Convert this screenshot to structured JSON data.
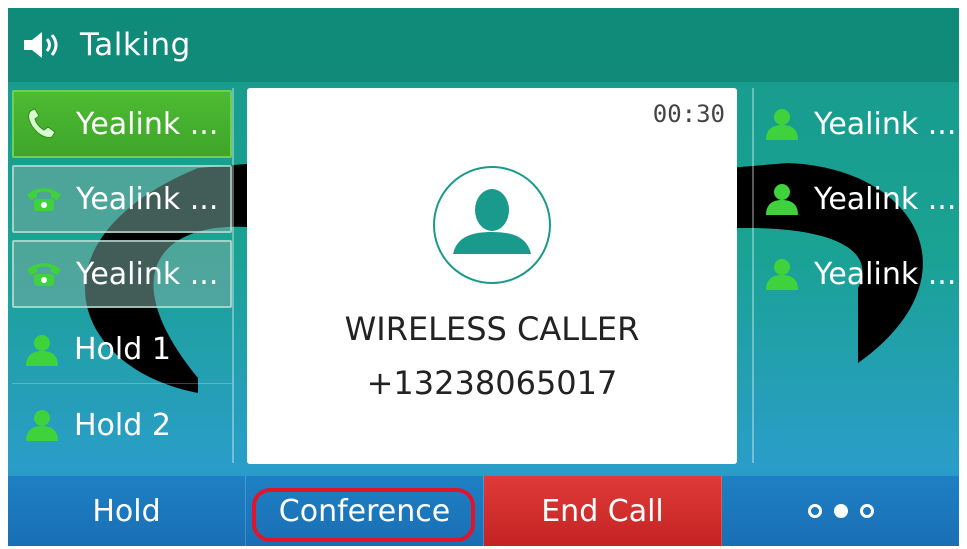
{
  "status": {
    "title": "Talking",
    "icon": "speaker-icon"
  },
  "left_lines": [
    {
      "label": "Yealink ...",
      "icon": "phone-active-icon",
      "state": "active"
    },
    {
      "label": "Yealink ...",
      "icon": "phone-hold-icon",
      "state": "held"
    },
    {
      "label": "Yealink ...",
      "icon": "phone-hold-icon",
      "state": "held"
    },
    {
      "label": "Hold 1",
      "icon": "contact-icon",
      "state": "plain"
    },
    {
      "label": "Hold 2",
      "icon": "contact-icon",
      "state": "plain"
    }
  ],
  "right_lines": [
    {
      "label": "Yealink ...",
      "icon": "contact-icon"
    },
    {
      "label": "Yealink ...",
      "icon": "contact-icon"
    },
    {
      "label": "Yealink ...",
      "icon": "contact-icon"
    }
  ],
  "call": {
    "timer": "00:30",
    "caller_name": "WIRELESS CALLER",
    "caller_number": "+13238065017",
    "avatar_icon": "caller-avatar-icon"
  },
  "softkeys": [
    {
      "label": "Hold"
    },
    {
      "label": "Conference",
      "highlighted": true
    },
    {
      "label": "End Call"
    },
    {
      "label": "",
      "icon": "more-options-icon"
    }
  ],
  "colors": {
    "active_line": "#4dbb32",
    "end_call": "#d22e2e",
    "softkey_bar": "#1e80c4",
    "highlight_ring": "#e0142a",
    "contact_green": "#3fd23c"
  }
}
